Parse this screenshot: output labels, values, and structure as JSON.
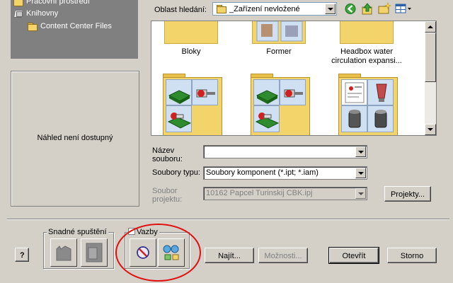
{
  "nav": {
    "items": [
      {
        "label": "Pracovní prostředí",
        "icon": "folder-icon"
      },
      {
        "label": "Knihovny",
        "icon": "library-icon"
      },
      {
        "label": "Content Center Files",
        "icon": "folder-icon"
      }
    ]
  },
  "preview": {
    "text": "Náhled není dostupný"
  },
  "search": {
    "label": "Oblast hledání:",
    "value": "_Zařízení nevložené",
    "toolbar": [
      "back-icon",
      "up-folder-icon",
      "new-folder-icon",
      "views-icon"
    ]
  },
  "file_list": {
    "items": [
      {
        "name": "Bloky"
      },
      {
        "name": "Former"
      },
      {
        "name": "Headbox water circulation expansi..."
      },
      {
        "name": ""
      },
      {
        "name": ""
      },
      {
        "name": ""
      }
    ]
  },
  "form": {
    "file_name_label": "Název souboru:",
    "file_name_value": "",
    "file_types_label": "Soubory typu:",
    "file_types_value": "Soubory komponent (*.ipt; *.iam)",
    "project_file_label": "Soubor projektu:",
    "project_file_value": "10162 Papcel Turinskij CBK.ipj",
    "projects_button": "Projekty..."
  },
  "bottom": {
    "help_button": "?",
    "quick_launch_title": "Snadné spuštění",
    "bindings_title": "Vazby",
    "find_button": "Najít...",
    "options_button": "Možnosti...",
    "open_button": "Otevřít",
    "cancel_button": "Storno"
  },
  "colors": {
    "dialog_bg": "#d4d0c8",
    "nav_bg": "#808080",
    "folder": "#f2d46a",
    "annotation": "#e01010"
  }
}
